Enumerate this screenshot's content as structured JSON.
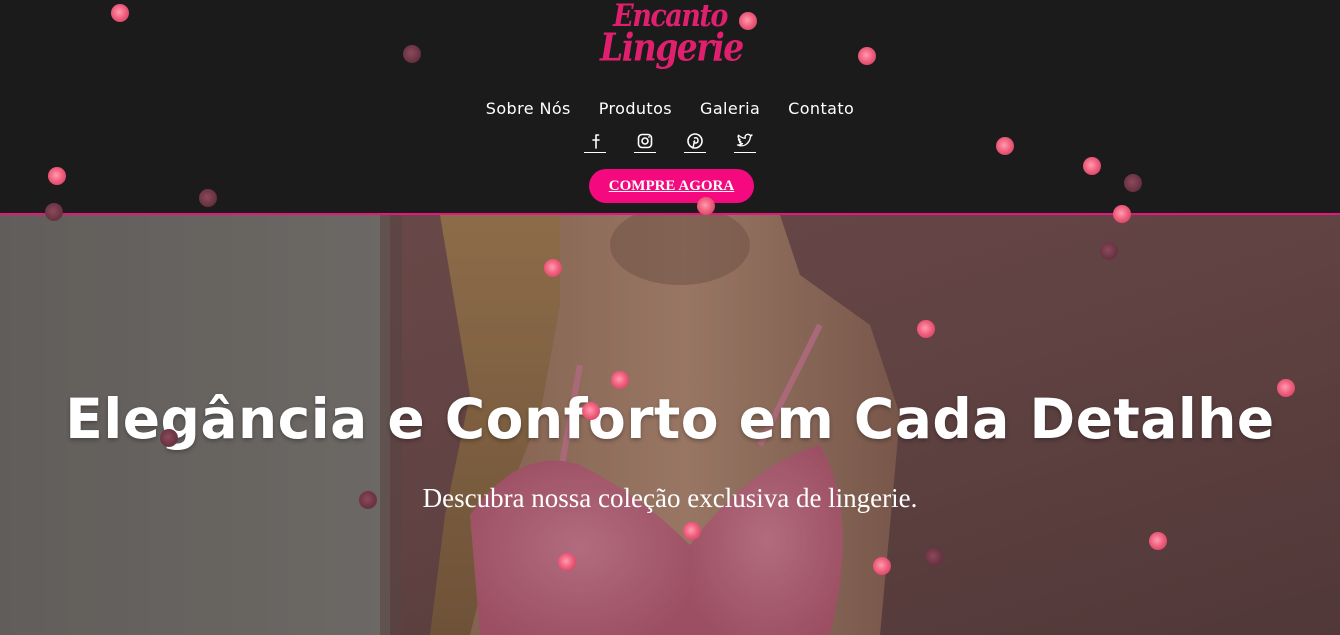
{
  "brand": {
    "logo_line1": "Encanto",
    "logo_line2": "Lingerie",
    "accent_color": "#e8157e",
    "logo_color": "#e0206f"
  },
  "nav": {
    "items": [
      {
        "label": "Sobre Nós"
      },
      {
        "label": "Produtos"
      },
      {
        "label": "Galeria"
      },
      {
        "label": "Contato"
      }
    ]
  },
  "social": {
    "icons": [
      "facebook-icon",
      "instagram-icon",
      "pinterest-icon",
      "twitter-icon"
    ]
  },
  "cta": {
    "label": "COMPRE AGORA",
    "color": "#f4097f"
  },
  "hero": {
    "title": "Elegância e Conforto em Cada Detalhe",
    "subtitle": "Descubra nossa coleção exclusiva de lingerie."
  },
  "colors": {
    "header_bg": "#1b1b1b",
    "petal": "#f0607e"
  }
}
